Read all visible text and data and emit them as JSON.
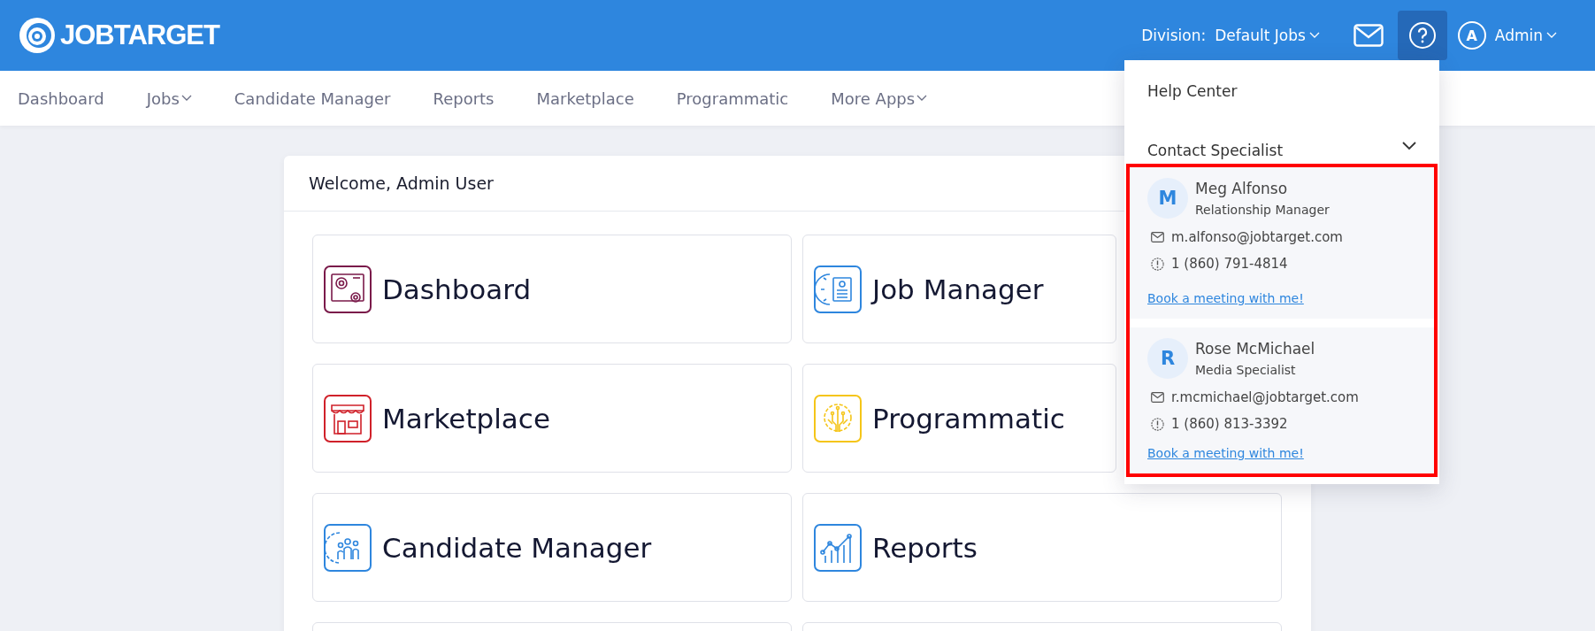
{
  "header": {
    "brand": "JOBTARGET",
    "division_label": "Division:",
    "division_value": "Default Jobs",
    "help_open": true,
    "user_initial": "A",
    "user_name": "Admin"
  },
  "nav": [
    {
      "label": "Dashboard",
      "has_menu": false
    },
    {
      "label": "Jobs",
      "has_menu": true
    },
    {
      "label": "Candidate Manager",
      "has_menu": false
    },
    {
      "label": "Reports",
      "has_menu": false
    },
    {
      "label": "Marketplace",
      "has_menu": false
    },
    {
      "label": "Programmatic",
      "has_menu": false
    },
    {
      "label": "More Apps",
      "has_menu": true
    }
  ],
  "welcome": {
    "title": "Welcome, Admin User",
    "tiles": [
      {
        "label": "Dashboard",
        "kind": "dashboard",
        "color": "#7a1a4a"
      },
      {
        "label": "Job Manager",
        "kind": "jobs",
        "color": "#2e86de"
      },
      {
        "label": "Marketplace",
        "kind": "store",
        "color": "#d0212a"
      },
      {
        "label": "Programmatic",
        "kind": "programmatic",
        "color": "#f5c518"
      },
      {
        "label": "Candidate Manager",
        "kind": "candidates",
        "color": "#2e86de"
      },
      {
        "label": "Reports",
        "kind": "reports",
        "color": "#2e86de"
      }
    ]
  },
  "help_menu": {
    "items": [
      "Help Center"
    ],
    "contact": {
      "label": "Contact Specialist",
      "expanded": true
    },
    "specialists": [
      {
        "initial": "M",
        "name": "Meg Alfonso",
        "role": "Relationship Manager",
        "email": "m.alfonso@jobtarget.com",
        "phone": "1 (860) 791-4814",
        "link": "Book a meeting with me!"
      },
      {
        "initial": "R",
        "name": "Rose McMichael",
        "role": "Media Specialist",
        "email": "r.mcmichael@jobtarget.com",
        "phone": "1 (860) 813-3392",
        "link": "Book a meeting with me!"
      }
    ]
  }
}
